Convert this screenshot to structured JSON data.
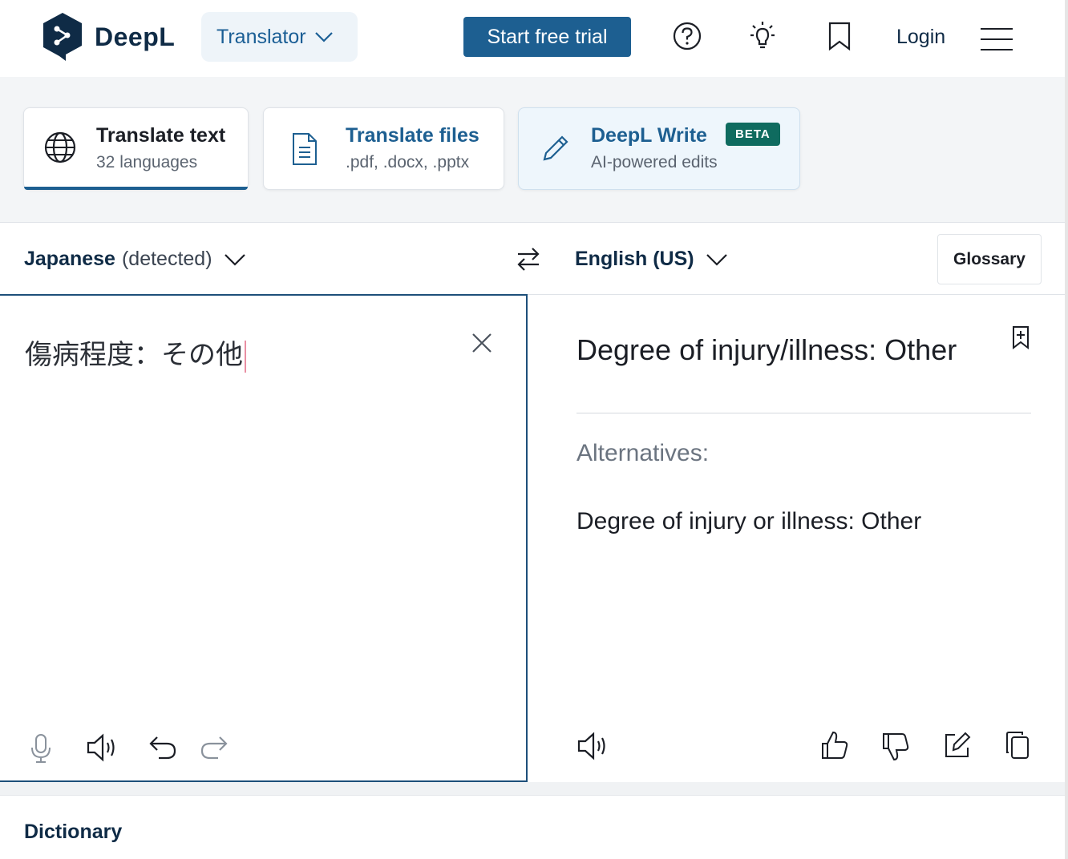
{
  "header": {
    "brand": "DeepL",
    "translator_label": "Translator",
    "trial_label": "Start free trial",
    "login_label": "Login",
    "icons": [
      "help-icon",
      "lightbulb-icon",
      "bookmark-icon",
      "menu-icon"
    ]
  },
  "modes": {
    "text": {
      "title": "Translate text",
      "sub": "32 languages"
    },
    "files": {
      "title": "Translate files",
      "sub": ".pdf, .docx, .pptx"
    },
    "write": {
      "title": "DeepL Write",
      "sub": "AI-powered edits",
      "badge": "BETA"
    }
  },
  "languages": {
    "source": "Japanese",
    "source_note": "(detected)",
    "target": "English (US)",
    "glossary_label": "Glossary"
  },
  "source_panel": {
    "text": "傷病程度：その他"
  },
  "target_panel": {
    "text": "Degree of injury/illness: Other",
    "alternatives_label": "Alternatives:",
    "alternatives": [
      "Degree of injury or illness: Other"
    ]
  },
  "dictionary": {
    "title": "Dictionary"
  },
  "colors": {
    "accent": "#1d5f91",
    "brand_dark": "#0f2b46",
    "beta": "#0f6b5f"
  }
}
